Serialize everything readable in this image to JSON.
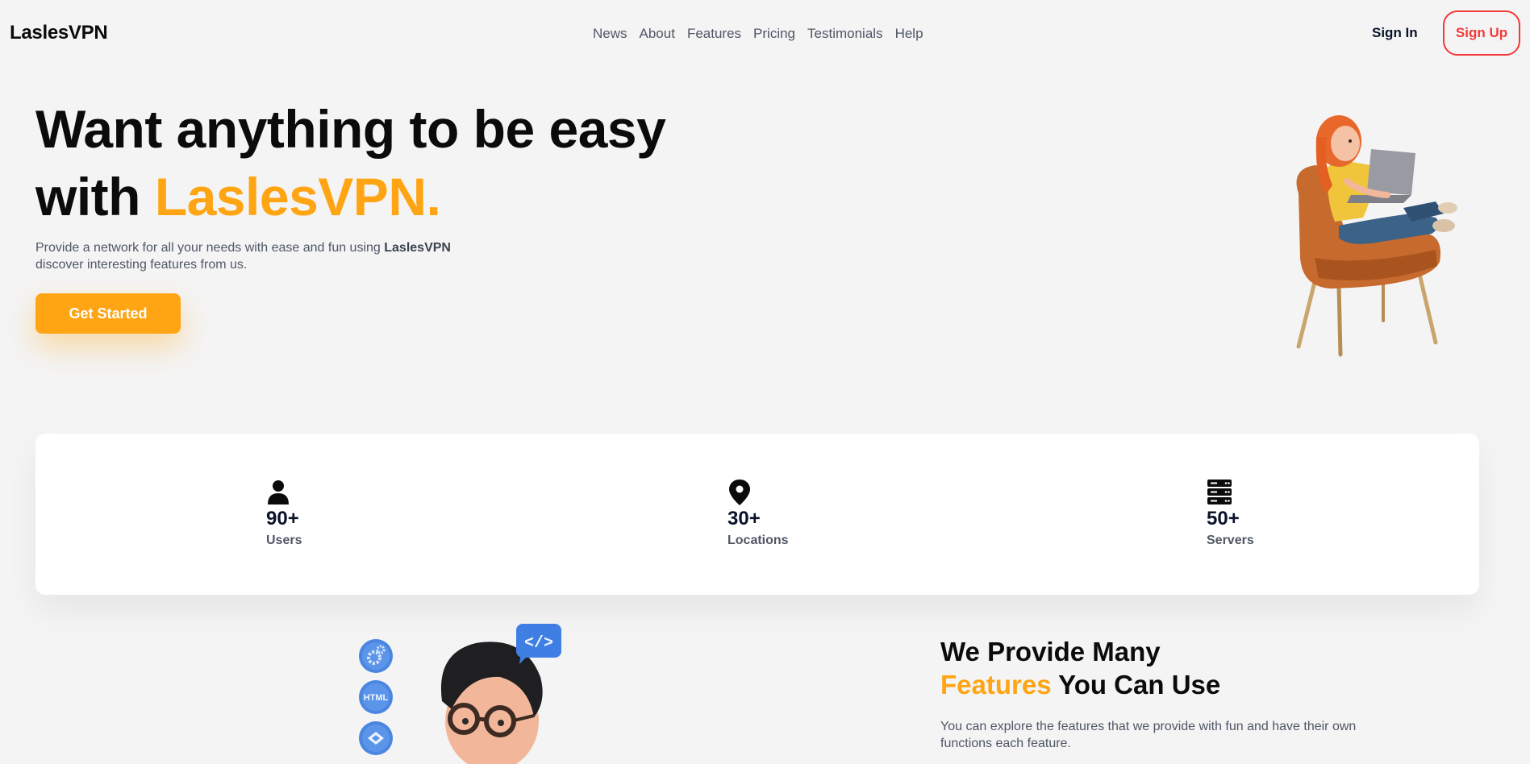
{
  "header": {
    "logo": "LaslesVPN",
    "nav": [
      "News",
      "About",
      "Features",
      "Pricing",
      "Testimonials",
      "Help"
    ],
    "sign_in": "Sign In",
    "sign_up": "Sign Up"
  },
  "hero": {
    "title_line1": "Want anything to be easy",
    "title_line2_prefix": "with ",
    "title_line2_accent": "LaslesVPN.",
    "desc_prefix": "Provide a network for all your needs with ease and fun using ",
    "desc_brand": "LaslesVPN",
    "desc_suffix": "discover interesting features from us.",
    "cta": "Get Started"
  },
  "stats": [
    {
      "icon": "user-icon",
      "value": "90+",
      "label": "Users"
    },
    {
      "icon": "location-pin-icon",
      "value": "30+",
      "label": "Locations"
    },
    {
      "icon": "server-icon",
      "value": "50+",
      "label": "Servers"
    }
  ],
  "features": {
    "title_line1": "We Provide Many",
    "title_accent": "Features",
    "title_rest": " You Can Use",
    "desc": "You can explore the features that we provide with fun and have their own functions each feature."
  },
  "colors": {
    "accent": "#ffa412",
    "signup_border": "#f53838",
    "text_muted": "#4f5665",
    "background": "#f4f4f4"
  }
}
